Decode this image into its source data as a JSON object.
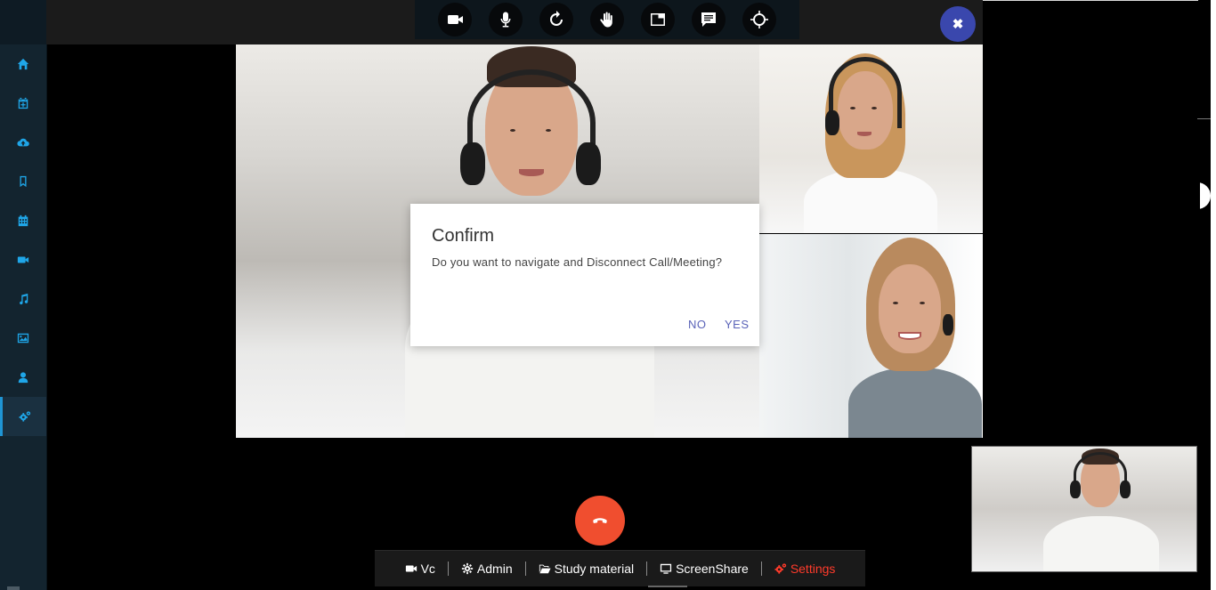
{
  "sidebar": {
    "items": [
      {
        "name": "home-icon"
      },
      {
        "name": "calendar-plus-icon"
      },
      {
        "name": "cloud-upload-icon"
      },
      {
        "name": "bookmark-icon"
      },
      {
        "name": "calendar-icon"
      },
      {
        "name": "video-icon"
      },
      {
        "name": "music-icon"
      },
      {
        "name": "image-icon"
      },
      {
        "name": "user-icon"
      },
      {
        "name": "cogs-icon",
        "active": true
      }
    ]
  },
  "toolbar": {
    "buttons": [
      "video-camera-icon",
      "microphone-icon",
      "refresh-icon",
      "raise-hand-icon",
      "layout-icon",
      "chat-icon",
      "crosshair-icon"
    ]
  },
  "close": {
    "label": "✖"
  },
  "dialog": {
    "title": "Confirm",
    "message": "Do you want to navigate and Disconnect Call/Meeting?",
    "no_label": "NO",
    "yes_label": "YES"
  },
  "bottom_bar": {
    "vc": "Vc",
    "admin": "Admin",
    "study": "Study material",
    "screenshare": "ScreenShare",
    "settings": "Settings"
  },
  "colors": {
    "sidebar_bg": "#13242f",
    "sidebar_icon": "#1fa6e8",
    "close_button": "#3a47ad",
    "end_call": "#f04e2f",
    "dialog_button": "#5a63b8",
    "active_tab": "#ff3b2b"
  }
}
